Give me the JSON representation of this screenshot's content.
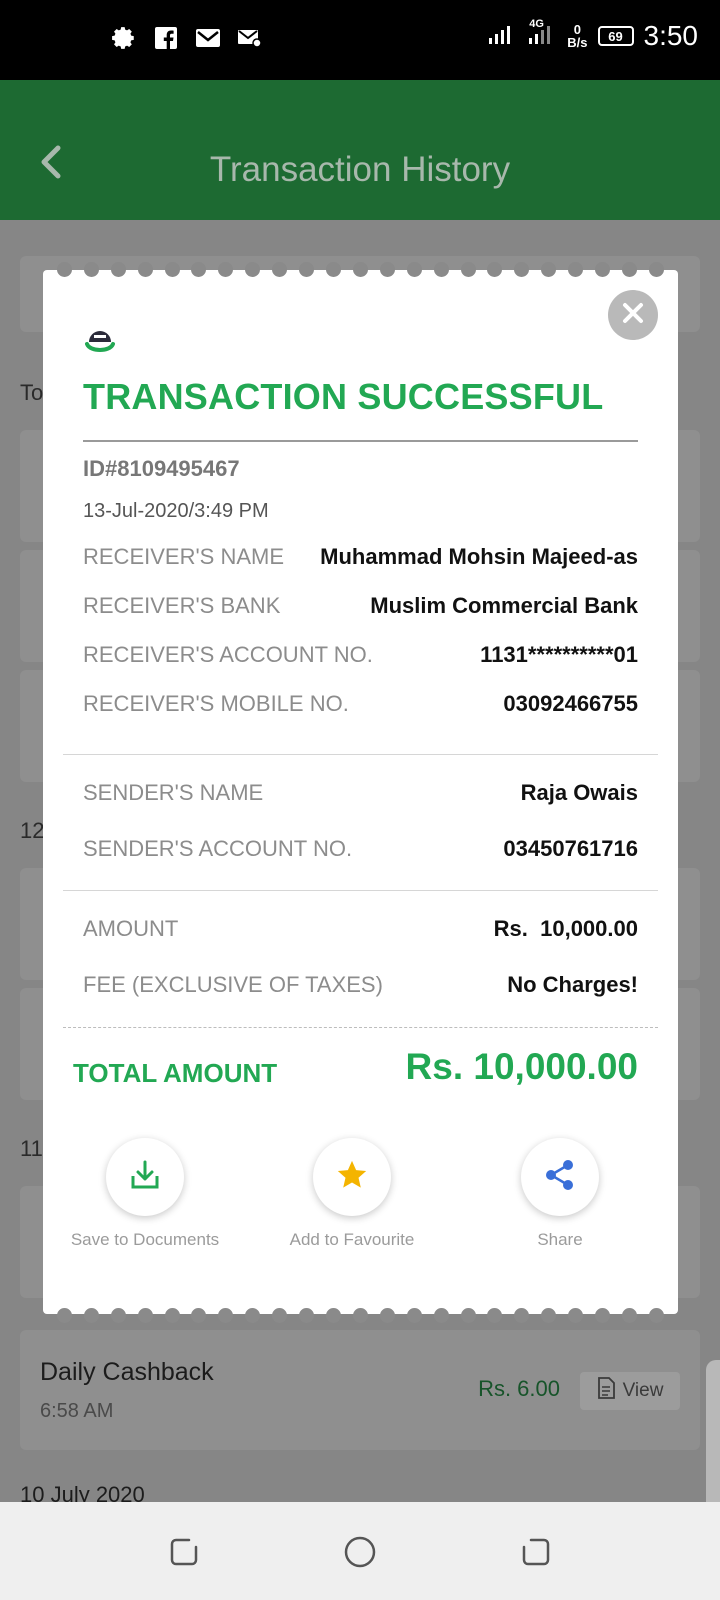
{
  "status_bar": {
    "time": "3:50",
    "network_type": "4G",
    "speed_value": "0",
    "speed_unit": "B/s",
    "battery": "69",
    "icons": [
      "gear-icon",
      "facebook-icon",
      "gmail-icon",
      "mail-settings-icon",
      "signal-icon",
      "battery-icon"
    ]
  },
  "header": {
    "title": "Transaction History"
  },
  "background_list": {
    "section_labels": [
      "To",
      "12",
      "11"
    ],
    "cashback_title": "Daily Cashback",
    "cashback_time": "6:58 AM",
    "cashback_amount": "Rs.  6.00",
    "view_label": "View",
    "next_date": "10 July 2020"
  },
  "receipt": {
    "title": "TRANSACTION SUCCESSFUL",
    "id": "ID#8109495467",
    "datetime": "13-Jul-2020/3:49 PM",
    "receiver": [
      {
        "label": "RECEIVER'S NAME",
        "value": "Muhammad Mohsin Majeed-as"
      },
      {
        "label": "RECEIVER'S BANK",
        "value": "Muslim Commercial Bank"
      },
      {
        "label": "RECEIVER'S ACCOUNT NO.",
        "value": "1131**********01"
      },
      {
        "label": "RECEIVER'S MOBILE NO.",
        "value": "03092466755"
      }
    ],
    "sender": [
      {
        "label": "SENDER'S NAME",
        "value": "Raja Owais"
      },
      {
        "label": "SENDER'S ACCOUNT NO.",
        "value": "03450761716"
      }
    ],
    "charges": [
      {
        "label": "AMOUNT",
        "value": "Rs.  10,000.00"
      },
      {
        "label": "FEE (EXCLUSIVE OF TAXES)",
        "value": "No Charges!"
      }
    ],
    "total_label": "TOTAL AMOUNT",
    "total_value": "Rs. 10,000.00",
    "actions": [
      {
        "label": "Save to Documents",
        "icon": "download-icon"
      },
      {
        "label": "Add to Favourite",
        "icon": "star-icon"
      },
      {
        "label": "Share",
        "icon": "share-icon"
      }
    ]
  },
  "colors": {
    "brand_green": "#1d6a32",
    "success_green": "#22a853",
    "star_yellow": "#f4b400",
    "share_blue": "#3a6fd8"
  }
}
